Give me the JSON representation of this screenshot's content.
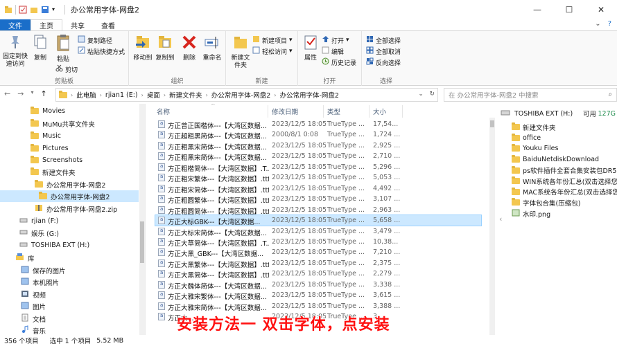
{
  "window": {
    "title": "办公常用字体-网盘2",
    "min": "—",
    "max": "☐",
    "close": "✕"
  },
  "tabs": [
    {
      "label": "文件"
    },
    {
      "label": "主页"
    },
    {
      "label": "共享"
    },
    {
      "label": "查看"
    }
  ],
  "ribbon": {
    "clipboard": {
      "label": "剪贴板",
      "pin": "固定到快速访问",
      "copy": "复制",
      "paste": "粘贴",
      "copy_path": "复制路径",
      "paste_shortcut": "粘贴快捷方式",
      "cut": "剪切"
    },
    "organize": {
      "label": "组织",
      "move_to": "移动到",
      "copy_to": "复制到",
      "delete": "删除",
      "rename": "重命名"
    },
    "new": {
      "label": "新建",
      "new_folder": "新建文件夹",
      "new_item": "新建项目",
      "easy_access": "轻松访问"
    },
    "open": {
      "label": "打开",
      "properties": "属性",
      "open": "打开",
      "edit": "编辑",
      "history": "历史记录"
    },
    "select": {
      "label": "选择",
      "select_all": "全部选择",
      "select_none": "全部取消",
      "invert": "反向选择"
    }
  },
  "address": {
    "crumbs": [
      "此电脑",
      "rjian1 (E:)",
      "桌面",
      "新建文件夹",
      "办公常用字体-网盘2",
      "办公常用字体-网盘2"
    ],
    "search_placeholder": "在 办公常用字体-网盘2 中搜索"
  },
  "nav": {
    "items": [
      {
        "label": "Movies"
      },
      {
        "label": "MuMu共享文件夹"
      },
      {
        "label": "Music"
      },
      {
        "label": "Pictures"
      },
      {
        "label": "Screenshots"
      },
      {
        "label": "新建文件夹"
      },
      {
        "label": "办公常用字体-网盘2"
      },
      {
        "label": "办公常用字体-网盘2"
      },
      {
        "label": "办公常用字体-网盘2.zip"
      },
      {
        "label": "rjian (F:)"
      },
      {
        "label": "娱乐 (G:)"
      },
      {
        "label": "TOSHIBA EXT (H:)"
      },
      {
        "label": "库"
      },
      {
        "label": "保存的图片"
      },
      {
        "label": "本机照片"
      },
      {
        "label": "视频"
      },
      {
        "label": "图片"
      },
      {
        "label": "文档"
      },
      {
        "label": "音乐"
      }
    ]
  },
  "list": {
    "headers": {
      "name": "名称",
      "date": "修改日期",
      "type": "类型",
      "size": "大小"
    },
    "rows": [
      {
        "name": "方正曾正国楷体---【大湾区数据...",
        "date": "2023/12/5 18:05",
        "type": "TrueType ...",
        "size": "17,54..."
      },
      {
        "name": "方正超粗黑简体---【大湾区数据...",
        "date": "2000/8/1 0:08",
        "type": "TrueType ...",
        "size": "1,724 ..."
      },
      {
        "name": "方正粗黑宋简体---【大湾区数据...",
        "date": "2023/12/5 18:05",
        "type": "TrueType ...",
        "size": "2,925 ..."
      },
      {
        "name": "方正粗黑宋简体---【大湾区数据...",
        "date": "2023/12/5 18:05",
        "type": "TrueType ...",
        "size": "2,710 ..."
      },
      {
        "name": "方正粗楷简体---【大湾区数据】.T...",
        "date": "2023/12/5 18:05",
        "type": "TrueType ...",
        "size": "5,296 ..."
      },
      {
        "name": "方正粗宋繁体---【大湾区数据】.ttf",
        "date": "2023/12/5 18:05",
        "type": "TrueType ...",
        "size": "5,053 ..."
      },
      {
        "name": "方正粗宋简体---【大湾区数据】.ttf",
        "date": "2023/12/5 18:05",
        "type": "TrueType ...",
        "size": "4,492 ..."
      },
      {
        "name": "方正粗圆繁体---【大湾区数据】.ttf",
        "date": "2023/12/5 18:05",
        "type": "TrueType ...",
        "size": "3,107 ..."
      },
      {
        "name": "方正粗圆简体---【大湾区数据】.ttf",
        "date": "2023/12/5 18:05",
        "type": "TrueType ...",
        "size": "2,963 ..."
      },
      {
        "name": "方正大标GBK---【大湾区数据...",
        "date": "2023/12/5 18:05",
        "type": "TrueType ...",
        "size": "5,658 ..."
      },
      {
        "name": "方正大标宋简体---【大湾区数据...",
        "date": "2023/12/5 18:05",
        "type": "TrueType ...",
        "size": "3,479 ..."
      },
      {
        "name": "方正大草简体---【大湾区数据】.T...",
        "date": "2023/12/5 18:05",
        "type": "TrueType ...",
        "size": "10,38..."
      },
      {
        "name": "方正大黑_GBK---【大湾区数据...",
        "date": "2023/12/5 18:05",
        "type": "TrueType ...",
        "size": "7,210 ..."
      },
      {
        "name": "方正大黑繁体---【大湾区数据】.ttf",
        "date": "2023/12/5 18:05",
        "type": "TrueType ...",
        "size": "2,375 ..."
      },
      {
        "name": "方正大黑简体---【大湾区数据】.ttf",
        "date": "2023/12/5 18:05",
        "type": "TrueType ...",
        "size": "2,279 ..."
      },
      {
        "name": "方正大魏体简体---【大湾区数据...",
        "date": "2023/12/5 18:05",
        "type": "TrueType ...",
        "size": "3,338 ..."
      },
      {
        "name": "方正大雅宋繁体---【大湾区数据...",
        "date": "2023/12/5 18:05",
        "type": "TrueType ...",
        "size": "3,615 ..."
      },
      {
        "name": "方正大雅宋简体---【大湾区数据...",
        "date": "2023/12/5 18:05",
        "type": "TrueType ...",
        "size": "3,388 ..."
      },
      {
        "name": "方正大...",
        "date": "2023/12/5 18:05",
        "type": "TrueType ...",
        "size": "3,..."
      }
    ]
  },
  "drive": {
    "name": "TOSHIBA EXT (H:)",
    "used": "可用",
    "free": "127G"
  },
  "right_items": [
    {
      "label": "新建文件夹"
    },
    {
      "label": "office"
    },
    {
      "label": "Youku Files"
    },
    {
      "label": "BaiduNetdiskDownload"
    },
    {
      "label": "ps软件插件全套合集安装包DR5人..."
    },
    {
      "label": "WIN系统各年份汇总(双击选择您需..."
    },
    {
      "label": "MAC系统各年份汇总(双击选择您需..."
    },
    {
      "label": "字体包合集(压缩包)"
    },
    {
      "label": "水印.png"
    }
  ],
  "status": {
    "count": "356 个项目",
    "selected": "选中 1 个项目",
    "size": "5.52 MB"
  },
  "subtitle": "安装方法一 双击字体，点安装",
  "colors": {
    "accent": "#1a6ec9",
    "selection": "#cce8ff",
    "subtitle": "#ff1010"
  }
}
